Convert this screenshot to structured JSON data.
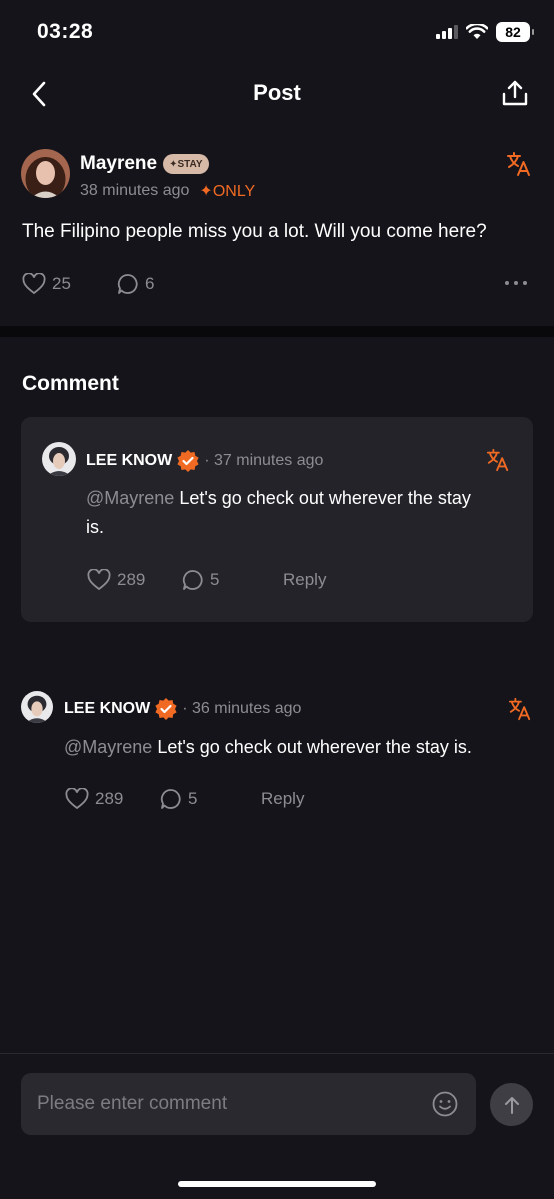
{
  "status_bar": {
    "time": "03:28",
    "battery": "82"
  },
  "nav": {
    "title": "Post"
  },
  "post": {
    "author": "Mayrene",
    "badge": "✦STAY",
    "time": "38 minutes ago",
    "visibility": "✦ONLY",
    "body": "The Filipino people miss you a lot. Will you come here?",
    "likes": "25",
    "comments": "6"
  },
  "comment_section": {
    "title": "Comment"
  },
  "comments": [
    {
      "author": "LEE KNOW",
      "time": "· 37 minutes ago",
      "mention": "@Mayrene",
      "text_line1": " Let's go check out wherever the stay",
      "text_line2": "is.",
      "likes": "289",
      "replies": "5",
      "reply_label": "Reply"
    },
    {
      "author": "LEE KNOW",
      "time": "· 36 minutes ago",
      "mention": "@Mayrene",
      "text": " Let's go check out wherever the stay is.",
      "likes": "289",
      "replies": "5",
      "reply_label": "Reply"
    }
  ],
  "composer": {
    "placeholder": "Please enter comment"
  },
  "colors": {
    "accent": "#f06a23",
    "background": "#15141a",
    "card": "#24232a",
    "muted": "#8d8c93"
  }
}
